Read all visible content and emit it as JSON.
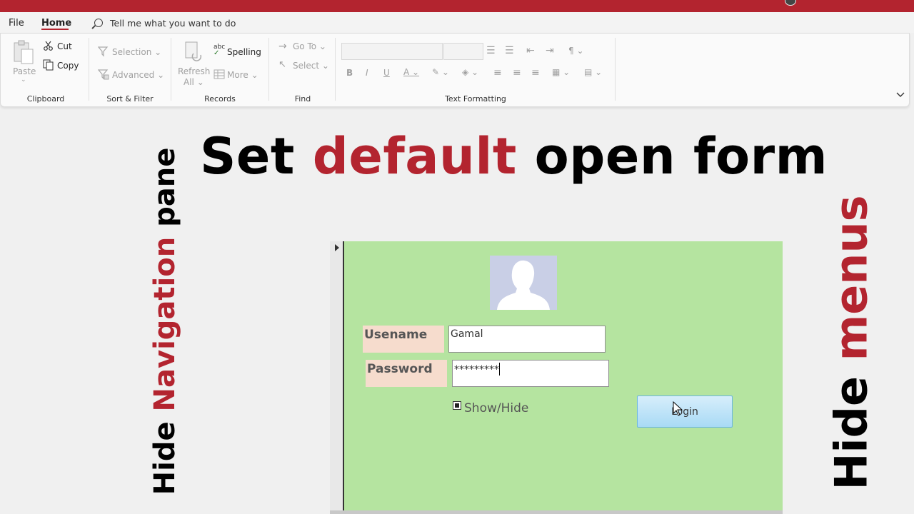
{
  "titlebar": {
    "color": "#b3242f"
  },
  "menubar": {
    "tabs": [
      {
        "label": "File"
      },
      {
        "label": "Home",
        "active": true
      }
    ],
    "tell_me": "Tell me what you want to do"
  },
  "ribbon": {
    "clipboard": {
      "paste": "Paste",
      "cut": "Cut",
      "copy": "Copy",
      "group": "Clipboard"
    },
    "sort_filter": {
      "selection": "Selection",
      "advanced": "Advanced",
      "group": "Sort & Filter"
    },
    "records": {
      "refresh": "Refresh",
      "all": "All",
      "spelling": "Spelling",
      "more": "More",
      "group": "Records"
    },
    "find": {
      "goto": "Go To",
      "select": "Select",
      "group": "Find"
    },
    "text_formatting": {
      "group": "Text Formatting"
    }
  },
  "overlay": {
    "title_part1": "Set ",
    "title_red": "default",
    "title_part2": " open form",
    "left_part1": "Hide ",
    "left_red": "Navigation",
    "left_part2": " pane",
    "right_part1": "Hide ",
    "right_red": "menus",
    "accent_color": "#b3242f"
  },
  "form": {
    "username_label": "Usename",
    "username_value": "Gamal",
    "password_label": "Password",
    "password_value": "*********",
    "show_hide_label": "Show/Hide",
    "show_hide_checked": true,
    "login_button": "Login",
    "background": "#b5e4a0"
  }
}
